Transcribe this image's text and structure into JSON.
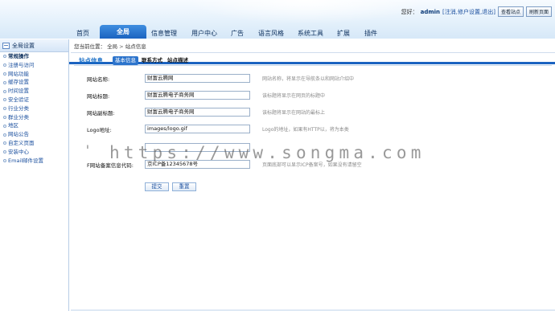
{
  "header": {
    "user_label": "您好：",
    "username": "admin",
    "user_links": "[注消,修户设置,退出]",
    "btn_site": "查看站点",
    "btn_home": "刷新页面"
  },
  "nav": {
    "items": [
      "首页",
      "全局",
      "信息管理",
      "用户中心",
      "广告",
      "语言风格",
      "系统工具",
      "扩展",
      "插件"
    ],
    "active": "全局"
  },
  "sidebar": {
    "title": "全局设置",
    "items": [
      "常规操作",
      "注册与访问",
      "网站功能",
      "缓存设置",
      "时间设置",
      "安全验证",
      "行业分类",
      "群业分类",
      "地区",
      "网站公告",
      "自定义页面",
      "安装中心",
      "Email邮件设置"
    ],
    "active_index": 0
  },
  "breadcrumb": {
    "prefix": "您当前位置：",
    "part1": "全局",
    "sep": ">",
    "part2": "站点信息"
  },
  "tabs": {
    "title": "站点信息",
    "active": "基本信息",
    "contact": "联系方式",
    "desc": "站点描述"
  },
  "form": {
    "rows": [
      {
        "label": "网站名称:",
        "value": "财富云腾网",
        "hint": "网站名称，将显示在导航条以和网站介绍中"
      },
      {
        "label": "网站标题:",
        "value": "财富云腾电子商务网",
        "hint": "该标题将显示在网页的标题中"
      },
      {
        "label": "网站副标题:",
        "value": "财富云腾电子商务网",
        "hint": "该标题将显示在网站的最标上"
      },
      {
        "label": "Logo地址:",
        "value": "images/logo.gif",
        "hint": "Logo的地址，如果有HTTP以，将为本类"
      },
      {
        "label": "I",
        "value": "",
        "hint": ""
      },
      {
        "label": "F网站备案信息代码:",
        "value": "京ICP备12345678号",
        "hint": "页面底部可以显示ICP备案号，如果没有请留空"
      }
    ]
  },
  "buttons": {
    "submit": "提交",
    "reset": "重置"
  },
  "watermark": "https://www.songma.com"
}
